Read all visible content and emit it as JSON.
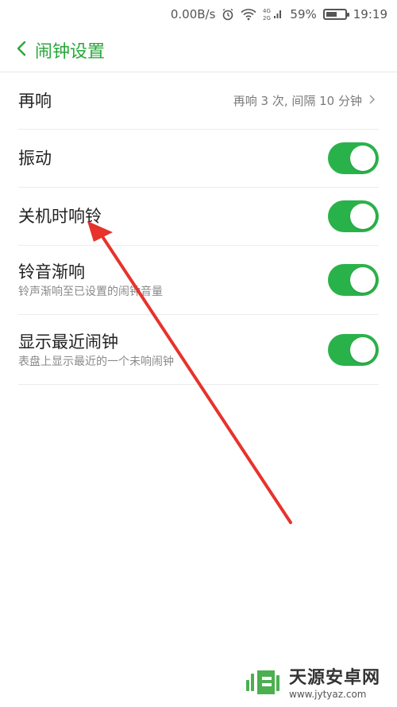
{
  "status": {
    "speed": "0.00B/s",
    "network": "4G 2G",
    "battery_percent": "59%",
    "battery_level": 0.59,
    "time": "19:19"
  },
  "header": {
    "back_icon": "chevron-left-icon",
    "title": "闹钟设置"
  },
  "settings": [
    {
      "title": "再响",
      "value": "再响 3 次, 间隔 10 分钟"
    },
    {
      "title": "振动",
      "enabled": true
    },
    {
      "title": "关机时响铃",
      "enabled": true
    },
    {
      "title": "铃音渐响",
      "subtitle": "铃声渐响至已设置的闹钟音量",
      "enabled": true
    },
    {
      "title": "显示最近闹钟",
      "subtitle": "表盘上显示最近的一个未响闹钟",
      "enabled": true
    }
  ],
  "colors": {
    "accent": "#26a83a",
    "toggle_on": "#2ab24a",
    "arrow": "#e8322c"
  },
  "watermark": {
    "name": "天源安卓网",
    "url": "www.jytyaz.com"
  }
}
